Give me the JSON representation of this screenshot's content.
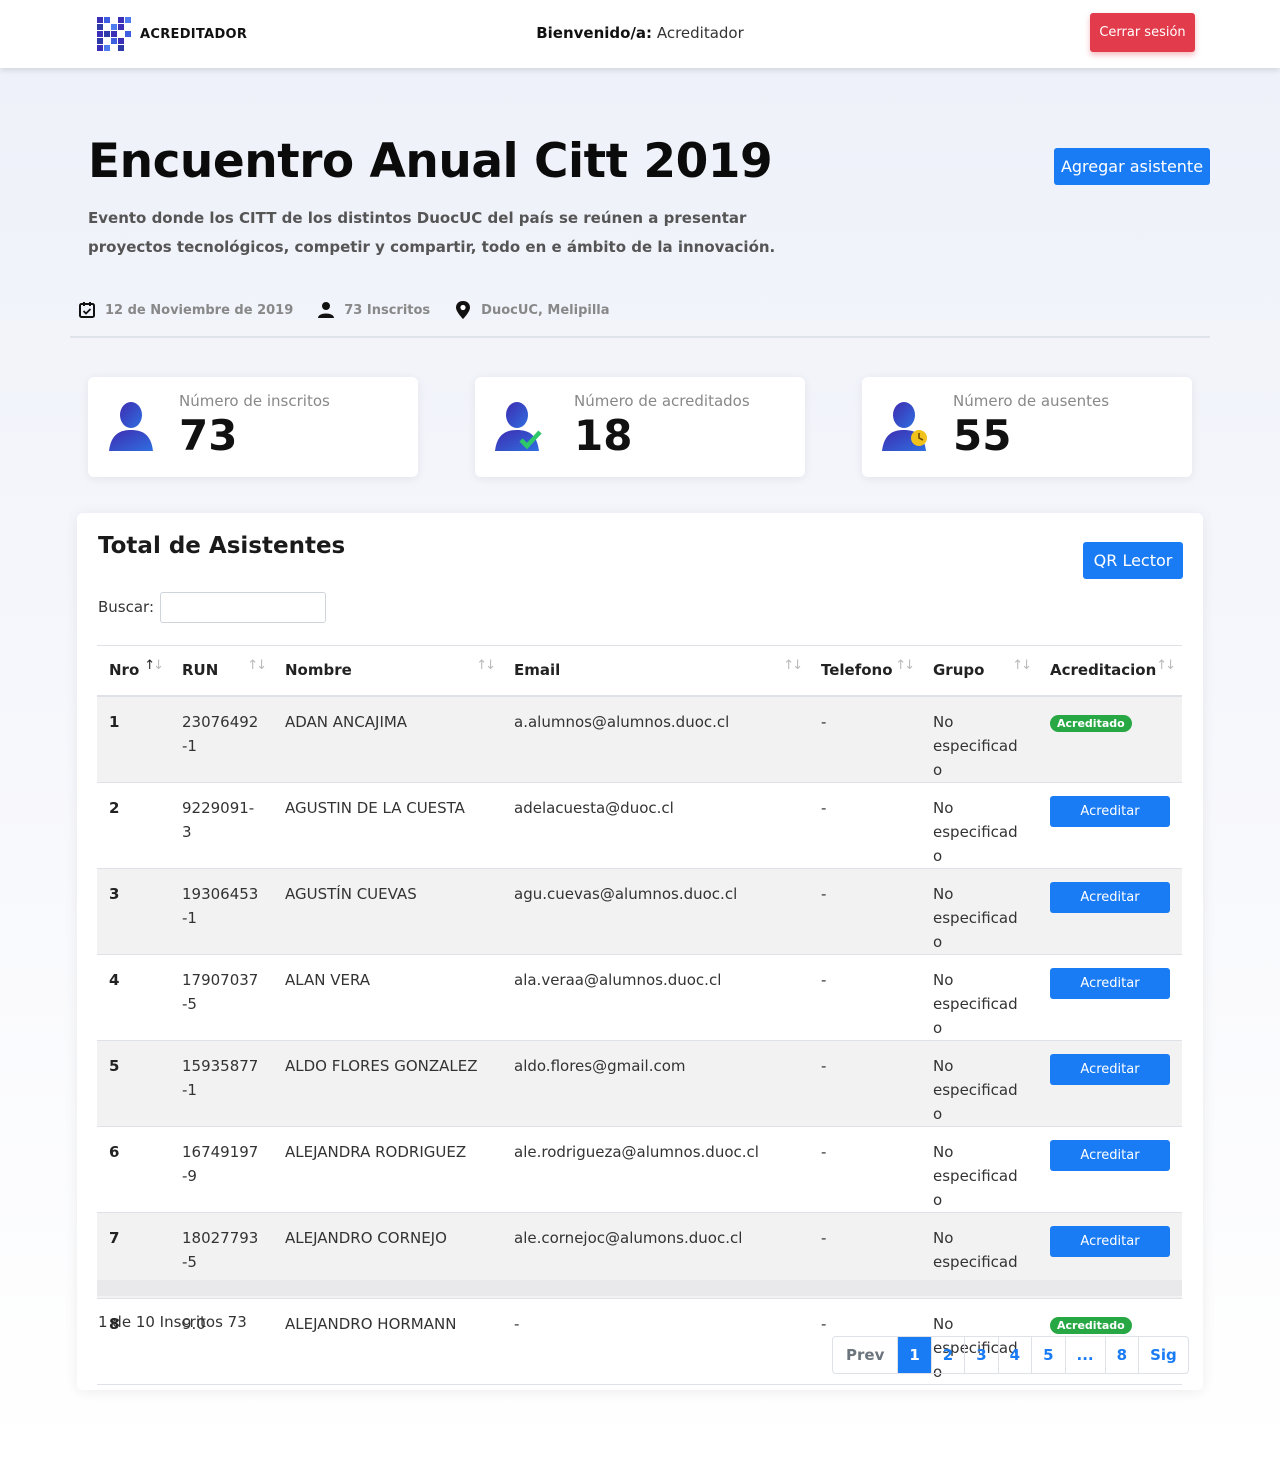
{
  "navbar": {
    "brand": "ACREDITADOR",
    "welcome_label": "Bienvenido/a:",
    "welcome_user": "Acreditador",
    "logout_label": "Cerrar sesión"
  },
  "event": {
    "title": "Encuentro Anual Citt 2019",
    "description": "Evento donde los CITT de los distintos DuocUC del país se reúnen a presentar proyectos tecnológicos, competir y compartir, todo en e ámbito de la innovación.",
    "add_attendee_label": "Agregar asistente",
    "date": "12 de Noviembre de 2019",
    "registered_text": "73 Inscritos",
    "location": "DuocUC, Melipilla"
  },
  "stats": [
    {
      "label": "Número de inscritos",
      "value": "73",
      "icon": "user-icon"
    },
    {
      "label": "Número de acreditados",
      "value": "18",
      "icon": "user-check-icon"
    },
    {
      "label": "Número de ausentes",
      "value": "55",
      "icon": "user-clock-icon"
    }
  ],
  "panel": {
    "title": "Total de Asistentes",
    "qr_label": "QR Lector",
    "search_label": "Buscar:",
    "search_value": ""
  },
  "table": {
    "headers": [
      "Nro",
      "RUN",
      "Nombre",
      "Email",
      "Telefono",
      "Grupo",
      "Acreditacion"
    ],
    "rows": [
      {
        "nro": "1",
        "run": "23076492-1",
        "nombre": "ADAN ANCAJIMA",
        "email": "a.alumnos@alumnos.duoc.cl",
        "telefono": "-",
        "grupo": "No especificado",
        "status": "Acreditado"
      },
      {
        "nro": "2",
        "run": "9229091-3",
        "nombre": "AGUSTIN DE LA CUESTA",
        "email": "adelacuesta@duoc.cl",
        "telefono": "-",
        "grupo": "No especificado",
        "status": "Acreditar"
      },
      {
        "nro": "3",
        "run": "19306453-1",
        "nombre": "AGUSTÍN CUEVAS",
        "email": "agu.cuevas@alumnos.duoc.cl",
        "telefono": "-",
        "grupo": "No especificado",
        "status": "Acreditar"
      },
      {
        "nro": "4",
        "run": "17907037-5",
        "nombre": "ALAN VERA",
        "email": "ala.veraa@alumnos.duoc.cl",
        "telefono": "-",
        "grupo": "No especificado",
        "status": "Acreditar"
      },
      {
        "nro": "5",
        "run": "15935877-1",
        "nombre": "ALDO FLORES GONZALEZ",
        "email": "aldo.flores@gmail.com",
        "telefono": "-",
        "grupo": "No especificado",
        "status": "Acreditar"
      },
      {
        "nro": "6",
        "run": "16749197-9",
        "nombre": "ALEJANDRA RODRIGUEZ",
        "email": "ale.rodrigueza@alumnos.duoc.cl",
        "telefono": "-",
        "grupo": "No especificado",
        "status": "Acreditar"
      },
      {
        "nro": "7",
        "run": "18027793-5",
        "nombre": "ALEJANDRO CORNEJO",
        "email": "ale.cornejoc@alumons.duoc.cl",
        "telefono": "-",
        "grupo": "No especificado",
        "status": "Acreditar"
      },
      {
        "nro": "8",
        "run": "9.0",
        "nombre": "ALEJANDRO HORMANN",
        "email": "-",
        "telefono": "-",
        "grupo": "No especificado",
        "status": "Acreditado"
      }
    ]
  },
  "footer": {
    "info": "1 de 10 Inscritos 73",
    "pages": [
      "Prev",
      "1",
      "2",
      "3",
      "4",
      "5",
      "...",
      "8",
      "Sig"
    ],
    "active_page": "1"
  },
  "colors": {
    "primary": "#1a7cf5",
    "danger": "#e23b4b",
    "success": "#28a745"
  }
}
